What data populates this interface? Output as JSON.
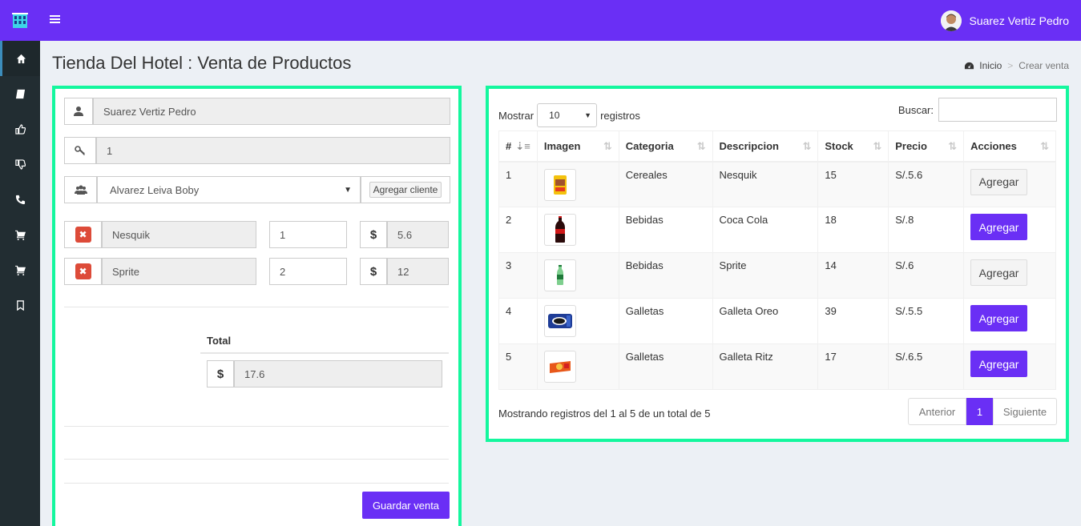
{
  "topbar": {
    "user_name": "Suarez Vertiz Pedro",
    "brand_color": "#6a2ff5"
  },
  "sidebar": {
    "items": [
      {
        "icon": "home-icon"
      },
      {
        "icon": "book-icon"
      },
      {
        "icon": "thumbs-up-icon"
      },
      {
        "icon": "thumbs-down-icon"
      },
      {
        "icon": "phone-icon"
      },
      {
        "icon": "cart-icon"
      },
      {
        "icon": "cart-icon"
      },
      {
        "icon": "bookmark-icon"
      }
    ]
  },
  "header": {
    "title": "Tienda Del Hotel : Venta de Productos",
    "breadcrumb_home": "Inicio",
    "breadcrumb_current": "Crear venta"
  },
  "sale": {
    "employee": "Suarez Vertiz Pedro",
    "key": "1",
    "client": "Alvarez Leiva Boby",
    "add_client_label": "Agregar cliente",
    "items": [
      {
        "name": "Nesquik",
        "qty": "1",
        "currency": "$",
        "subtotal": "5.6"
      },
      {
        "name": "Sprite",
        "qty": "2",
        "currency": "$",
        "subtotal": "12"
      }
    ],
    "total_label": "Total",
    "total_currency": "$",
    "total_value": "17.6",
    "save_label": "Guardar venta"
  },
  "products": {
    "show_label": "Mostrar",
    "page_length": "10",
    "records_label": "registros",
    "search_label": "Buscar:",
    "columns": [
      "#",
      "Imagen",
      "Categoria",
      "Descripcion",
      "Stock",
      "Precio",
      "Acciones"
    ],
    "rows": [
      {
        "id": "1",
        "category": "Cereales",
        "description": "Nesquik",
        "stock": "15",
        "price": "S/.5.6",
        "action": "Agregar",
        "style": "default"
      },
      {
        "id": "2",
        "category": "Bebidas",
        "description": "Coca Cola",
        "stock": "18",
        "price": "S/.8",
        "action": "Agregar",
        "style": "primary"
      },
      {
        "id": "3",
        "category": "Bebidas",
        "description": "Sprite",
        "stock": "14",
        "price": "S/.6",
        "action": "Agregar",
        "style": "default"
      },
      {
        "id": "4",
        "category": "Galletas",
        "description": "Galleta Oreo",
        "stock": "39",
        "price": "S/.5.5",
        "action": "Agregar",
        "style": "primary"
      },
      {
        "id": "5",
        "category": "Galletas",
        "description": "Galleta Ritz",
        "stock": "17",
        "price": "S/.6.5",
        "action": "Agregar",
        "style": "primary"
      }
    ],
    "info": "Mostrando registros del 1 al 5 de un total de 5",
    "prev_label": "Anterior",
    "current_page": "1",
    "next_label": "Siguiente"
  }
}
